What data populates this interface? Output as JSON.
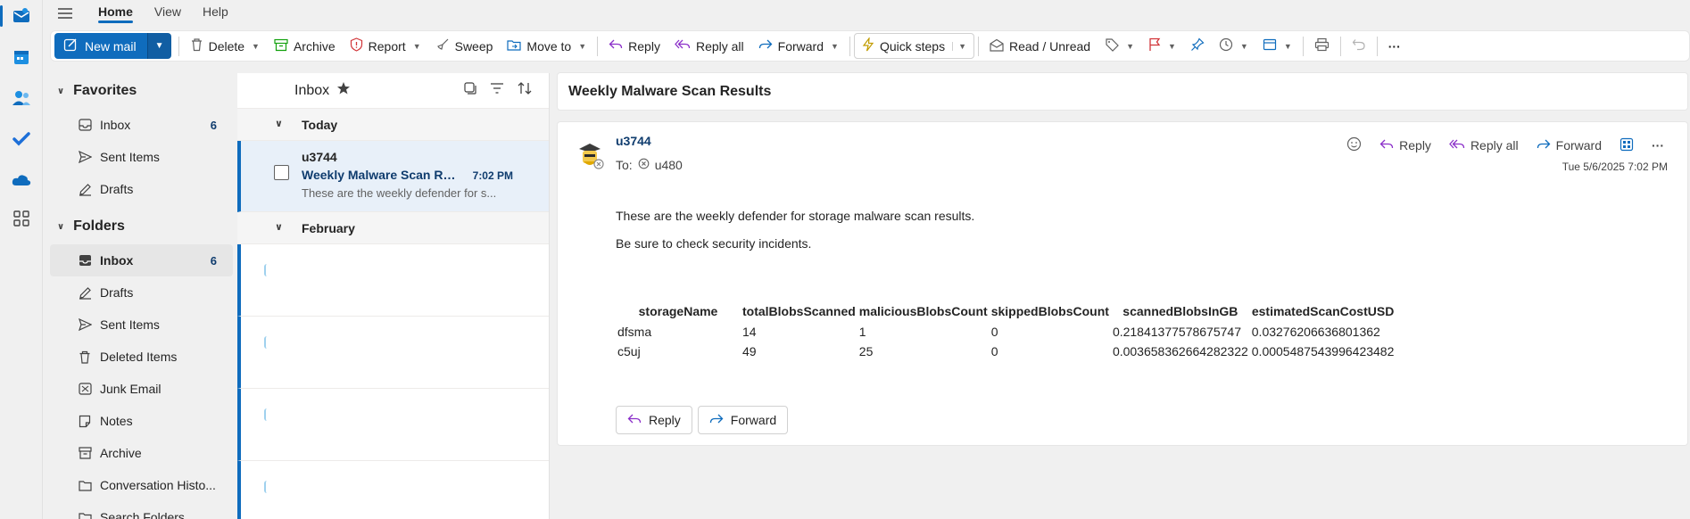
{
  "nav": {
    "tabs": [
      {
        "label": "Home"
      },
      {
        "label": "View"
      },
      {
        "label": "Help"
      }
    ]
  },
  "ribbon": {
    "new_mail": "New mail",
    "delete": "Delete",
    "archive": "Archive",
    "report": "Report",
    "sweep": "Sweep",
    "move_to": "Move to",
    "reply": "Reply",
    "reply_all": "Reply all",
    "forward": "Forward",
    "quick_steps": "Quick steps",
    "read_unread": "Read / Unread",
    "more": "···"
  },
  "sidebar": {
    "favorites_label": "Favorites",
    "favorites": [
      {
        "label": "Inbox",
        "count": "6"
      },
      {
        "label": "Sent Items",
        "count": ""
      },
      {
        "label": "Drafts",
        "count": ""
      }
    ],
    "folders_label": "Folders",
    "folders": [
      {
        "label": "Inbox",
        "count": "6"
      },
      {
        "label": "Drafts",
        "count": ""
      },
      {
        "label": "Sent Items",
        "count": ""
      },
      {
        "label": "Deleted Items",
        "count": ""
      },
      {
        "label": "Junk Email",
        "count": ""
      },
      {
        "label": "Notes",
        "count": ""
      },
      {
        "label": "Archive",
        "count": ""
      },
      {
        "label": "Conversation Histo...",
        "count": ""
      },
      {
        "label": "Search Folders",
        "count": ""
      }
    ]
  },
  "message_list": {
    "title": "Inbox",
    "groups": [
      {
        "label": "Today"
      },
      {
        "label": "February"
      }
    ],
    "items": [
      {
        "from": "u3744",
        "subject": "Weekly Malware Scan Re...",
        "time": "7:02 PM",
        "preview": "These are the weekly defender for s..."
      }
    ]
  },
  "reading_pane": {
    "subject": "Weekly Malware Scan Results",
    "sender": "u3744",
    "to_label": "To:",
    "to": "u480",
    "date": "Tue 5/6/2025 7:02 PM",
    "actions": {
      "reply": "Reply",
      "reply_all": "Reply all",
      "forward": "Forward"
    },
    "body": [
      "These are the weekly defender for storage malware scan results.",
      "Be sure to check security incidents."
    ],
    "table": {
      "headers": [
        "storageName",
        "totalBlobsScanned",
        "maliciousBlobsCount",
        "skippedBlobsCount",
        "scannedBlobsInGB",
        "estimatedScanCostUSD"
      ],
      "rows": [
        [
          "dfsma",
          "14",
          "1",
          "0",
          "0.21841377578675747",
          "0.03276206636801362"
        ],
        [
          "c5uj",
          "49",
          "25",
          "0",
          "0.003658362664282322",
          "0.0005487543996423482"
        ]
      ]
    },
    "footer_buttons": {
      "reply": "Reply",
      "forward": "Forward"
    }
  },
  "colors": {
    "accent": "#0f6cbd",
    "reply_icon": "#8b2fc9",
    "forward_icon": "#0f6cbd"
  }
}
